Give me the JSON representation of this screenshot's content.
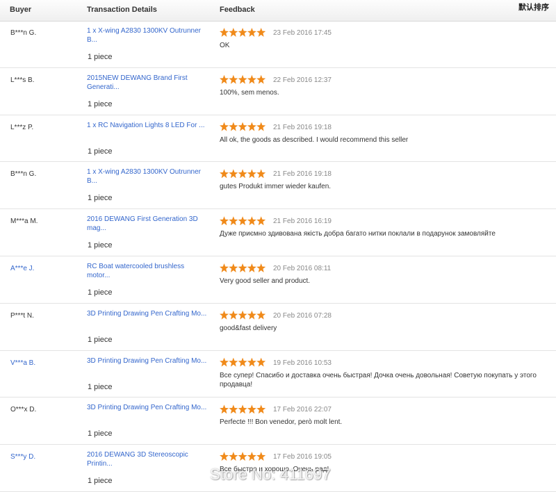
{
  "header": {
    "buyer": "Buyer",
    "details": "Transaction Details",
    "feedback": "Feedback",
    "sort": "默认排序"
  },
  "colors": {
    "link": "#3366cc",
    "star": "#f08a1a",
    "date": "#888888"
  },
  "star_icon": "star-icon",
  "rows": [
    {
      "buyer": "B***n G.",
      "buyer_link": false,
      "product": "1 x X-wing A2830 1300KV Outrunner\nB...",
      "qty": "1 piece",
      "rating": 5,
      "date": "23 Feb 2016 17:45",
      "comment": "OK"
    },
    {
      "buyer": "L***s B.",
      "buyer_link": false,
      "product": "2015NEW DEWANG Brand First\nGenerati...",
      "qty": "1 piece",
      "rating": 5,
      "date": "22 Feb 2016 12:37",
      "comment": "100%, sem menos."
    },
    {
      "buyer": "L***z P.",
      "buyer_link": false,
      "product": "1 x RC Navigation Lights 8 LED For ...",
      "qty": "1 piece",
      "rating": 5,
      "date": "21 Feb 2016 19:18",
      "comment": "All ok, the goods as described. I would recommend this seller"
    },
    {
      "buyer": "B***n G.",
      "buyer_link": false,
      "product": "1 x X-wing A2830 1300KV Outrunner\nB...",
      "qty": "1 piece",
      "rating": 5,
      "date": "21 Feb 2016 19:18",
      "comment": "gutes Produkt immer wieder kaufen."
    },
    {
      "buyer": "M***a M.",
      "buyer_link": false,
      "product": "2016 DEWANG First Generation 3D\nmag...",
      "qty": "1 piece",
      "rating": 5,
      "date": "21 Feb 2016 16:19",
      "comment": "Дуже приємно здивована якість добра багато нитки поклали в подарунок замовляйте"
    },
    {
      "buyer": "A***e J.",
      "buyer_link": true,
      "product": "RC Boat watercooled brushless\nmotor...",
      "qty": "1 piece",
      "rating": 5,
      "date": "20 Feb 2016 08:11",
      "comment": "Very good seller and product."
    },
    {
      "buyer": "P***t N.",
      "buyer_link": false,
      "product": "3D Printing Drawing Pen Crafting Mo...",
      "qty": "1 piece",
      "rating": 5,
      "date": "20 Feb 2016 07:28",
      "comment": "good&fast delivery"
    },
    {
      "buyer": "V***a B.",
      "buyer_link": true,
      "product": "3D Printing Drawing Pen Crafting Mo...",
      "qty": "1 piece",
      "rating": 5,
      "date": "19 Feb 2016 10:53",
      "comment": "Все супер! Спасибо и доставка очень быстрая! Дочка очень довольная! Советую покупать у этого продавца!"
    },
    {
      "buyer": "O***x D.",
      "buyer_link": false,
      "product": "3D Printing Drawing Pen Crafting Mo...",
      "qty": "1 piece",
      "rating": 5,
      "date": "17 Feb 2016 22:07",
      "comment": "Perfecte !!! Bon venedor, però molt lent."
    },
    {
      "buyer": "S***y D.",
      "buyer_link": true,
      "product": "2016 DEWANG 3D Stereoscopic\nPrintin...",
      "qty": "1 piece",
      "rating": 5,
      "date": "17 Feb 2016 19:05",
      "comment": "Все быстро и хорошо. Очень рад!"
    }
  ],
  "watermark": "Store No: 411697"
}
